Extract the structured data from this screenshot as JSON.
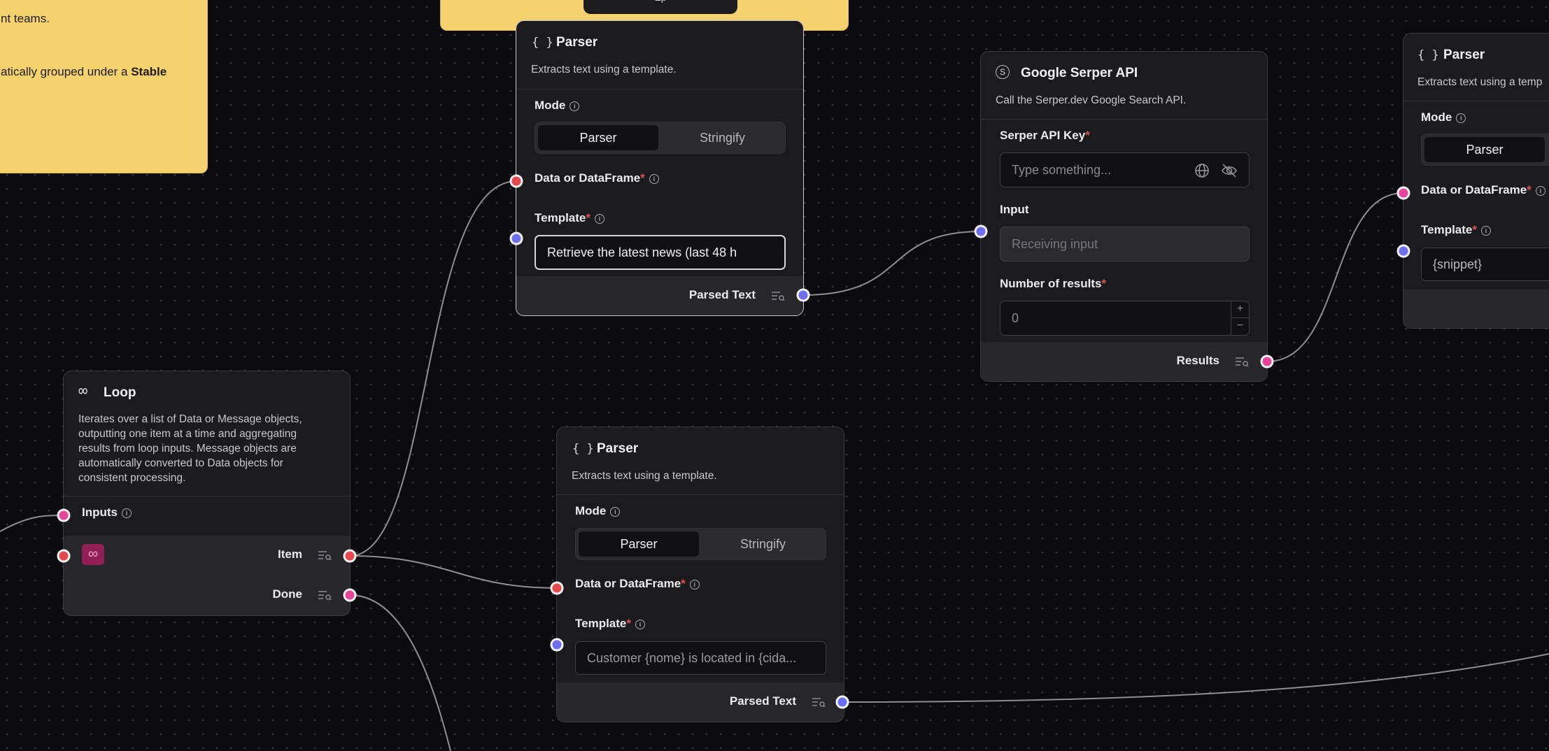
{
  "sticky_note": {
    "line1": "nt teams.",
    "line2_prefix": "atically grouped under a ",
    "line2_bold": "Stable"
  },
  "top_node_button_fragment": "Ep",
  "parser_top": {
    "icon": "{ }",
    "title": "Parser",
    "description": "Extracts text using a template.",
    "mode_label": "Mode",
    "mode_options": [
      "Parser",
      "Stringify"
    ],
    "mode_selected": "Parser",
    "data_label": "Data or DataFrame",
    "template_label": "Template",
    "template_value": "Retrieve the latest news (last 48 h",
    "output_label": "Parsed Text"
  },
  "serper": {
    "icon": "S",
    "title": "Google Serper API",
    "description": "Call the Serper.dev Google Search API.",
    "api_key_label": "Serper API Key",
    "api_key_placeholder": "Type something...",
    "input_label": "Input",
    "input_placeholder": "Receiving input",
    "results_label": "Number of results",
    "results_value": "0",
    "stepper_plus": "+",
    "stepper_minus": "−",
    "output_label": "Results"
  },
  "parser_right": {
    "icon": "{ }",
    "title": "Parser",
    "description": "Extracts text using a temp",
    "mode_label": "Mode",
    "mode_selected": "Parser",
    "data_label": "Data or DataFrame",
    "template_label": "Template",
    "template_value": "{snippet}"
  },
  "loop": {
    "icon": "∞",
    "title": "Loop",
    "description": "Iterates over a list of Data or Message objects, outputting one item at a time and aggregating results from loop inputs. Message objects are automatically converted to Data objects for consistent processing.",
    "inputs_label": "Inputs",
    "item_label": "Item",
    "done_label": "Done",
    "badge_icon": "∞"
  },
  "parser_bottom": {
    "icon": "{ }",
    "title": "Parser",
    "description": "Extracts text using a template.",
    "mode_label": "Mode",
    "mode_options": [
      "Parser",
      "Stringify"
    ],
    "mode_selected": "Parser",
    "data_label": "Data or DataFrame",
    "template_label": "Template",
    "template_value": "Customer {nome} is located in {cida...",
    "output_label": "Parsed Text"
  },
  "colors": {
    "note": "#f5d26e",
    "handle_red": "#e5484d",
    "handle_blue": "#6e6ff0",
    "handle_pink": "#e8449a",
    "edge": "#9a9aa0"
  }
}
